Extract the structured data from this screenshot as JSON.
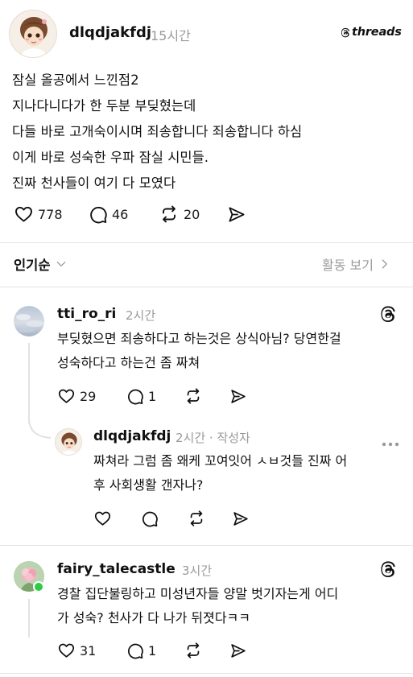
{
  "post": {
    "username": "dlqdjakfdj",
    "time": "15시간",
    "brand": "threads",
    "lines": [
      "잠실 올공에서 느낀점2",
      "지나다니다가 한 두분 부딪혔는데",
      "다들 바로 고개숙이시며 죄송합니다 죄송합니다 하심",
      "이게 바로 성숙한 우파 잠실 시민들.",
      "진짜 천사들이 여기 다 모였다"
    ],
    "likes": "778",
    "comments": "46",
    "reposts": "20"
  },
  "sort": {
    "label": "인기순",
    "activity": "활동 보기"
  },
  "replies": [
    {
      "username": "tti_ro_ri",
      "time": "2시간",
      "lines": [
        "부딪혔으면 죄송하다고 하는것은 상식아님? 당연한걸",
        "성숙하다고 하는건 좀 짜쳐"
      ],
      "likes": "29",
      "comments": "1"
    },
    {
      "username": "dlqdjakfdj",
      "time": "2시간 · 작성자",
      "lines": [
        "짜쳐라 그럼 좀 왜케 꼬여잇어 ㅅㅂ것들 진짜 어",
        "후 사회생활 갠자나?"
      ]
    },
    {
      "username": "fairy_talecastle",
      "time": "3시간",
      "lines": [
        "경찰 집단불링하고 미성년자들 양말 벗기자는게 어디",
        "가 성숙? 천사가 다 나가 뒤졋다ㅋㅋ"
      ],
      "likes": "31",
      "comments": "1"
    }
  ],
  "colors": {
    "text": "#101010",
    "muted": "#9a9a9a",
    "online": "#2ecc40"
  }
}
